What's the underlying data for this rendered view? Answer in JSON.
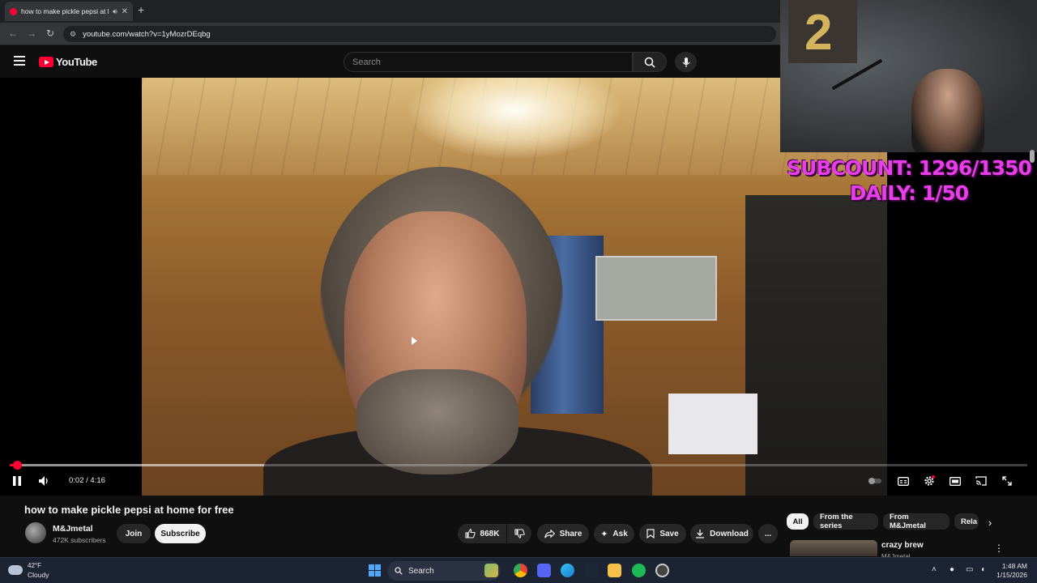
{
  "browser": {
    "tab_title": "how to make pickle pepsi at home for free",
    "address": "youtube.com/watch?v=1yMozrDEqbg",
    "new_tab_symbol": "+"
  },
  "masthead": {
    "logo_text": "YouTube",
    "search_placeholder": "Search"
  },
  "overlay": {
    "subcount": "SUBCOUNT: 1296/1350",
    "daily": "DAILY: 1/50",
    "balloon_digit": "2"
  },
  "player": {
    "current_time": "0:02",
    "time_separator": "/",
    "duration": "4:16",
    "progress_fraction": 0.008,
    "buffered_fraction": 0.25,
    "state": "playing"
  },
  "video": {
    "title": "how to make pickle pepsi at home for free",
    "channel": "M&Jmetal",
    "subscribers": "472K subscribers",
    "join_label": "Join",
    "subscribe_label": "Subscribe",
    "likes": "868K",
    "share_label": "Share",
    "ask_label": "Ask",
    "save_label": "Save",
    "download_label": "Download",
    "more_label": "..."
  },
  "recommendations": {
    "chips": [
      "All",
      "From the series",
      "From M&Jmetal",
      "Rela"
    ],
    "first": {
      "title": "crazy brew",
      "channel": "M&Jmetal"
    }
  },
  "taskbar": {
    "temperature": "42°F",
    "condition": "Cloudy",
    "search_label": "Search",
    "time": "1:48 AM",
    "date": "1/15/2026"
  },
  "colors": {
    "accent": "#ff0033",
    "overlay_text": "#e63fe8",
    "background": "#0f0f0f"
  }
}
